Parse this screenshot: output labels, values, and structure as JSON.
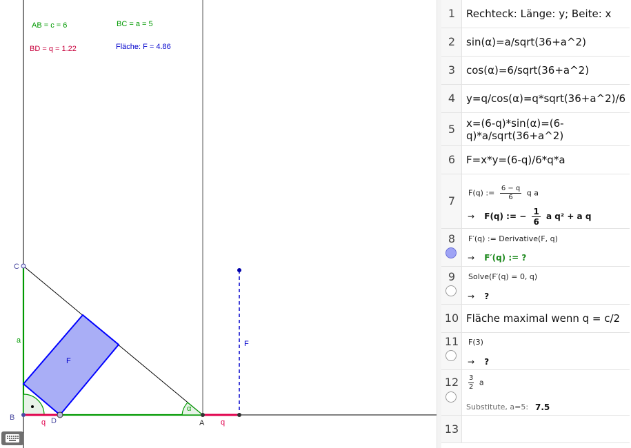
{
  "graphics": {
    "info_texts": {
      "ab": "AB = c = 6",
      "bc": "BC = a = 5",
      "bd": "BD = q = 1.22",
      "area": "Fläche: F = 4.86"
    },
    "point_labels": {
      "c": "C",
      "b": "B",
      "d": "D",
      "a": "A"
    },
    "segment_labels": {
      "a_side": "a",
      "q_left": "q",
      "q_right": "q",
      "f_rect": "F",
      "f_dashed": "F",
      "alpha": "α"
    },
    "colors": {
      "green": "#009900",
      "red": "#e0004c",
      "blue": "#0000ff",
      "rect_fill": "#9aa0f5",
      "magenta": "#c8003c"
    }
  },
  "cas": {
    "rows": [
      {
        "num": "1",
        "text": "Rechteck: Länge: y; Beite: x"
      },
      {
        "num": "2",
        "text": "sin(α)=a/sqrt(36+a^2)"
      },
      {
        "num": "3",
        "text": "cos(α)=6/sqrt(36+a^2)"
      },
      {
        "num": "4",
        "text": "y=q/cos(α)=q*sqrt(36+a^2)/6"
      },
      {
        "num": "5",
        "text_line1": "x=(6-q)*sin(α)=(6-",
        "text_line2": "q)*a/sqrt(36+a^2)"
      },
      {
        "num": "6",
        "text": "F=x*y=(6-q)/6*q*a"
      },
      {
        "num": "7",
        "input_prefix": "F(q) :=",
        "frac_num": "6 − q",
        "frac_den": "6",
        "input_suffix": "q a",
        "output_prefix": "F(q)  :=  −",
        "output_frac_num": "1",
        "output_frac_den": "6",
        "output_suffix": "a q² + a q"
      },
      {
        "num": "8",
        "input": "F′(q) := Derivative(F, q)",
        "output": "F′(q)  :=  ?"
      },
      {
        "num": "9",
        "input": "Solve(F′(q) = 0, q)",
        "output": "?"
      },
      {
        "num": "10",
        "text": "Fläche maximal wenn q = c/2"
      },
      {
        "num": "11",
        "input": "F(3)",
        "output": "?"
      },
      {
        "num": "12",
        "frac_num": "3",
        "frac_den": "2",
        "input_suffix": "a",
        "sub_label": "Substitute, a=5:",
        "sub_value": "7.5"
      },
      {
        "num": "13",
        "text": ""
      }
    ],
    "arrow": "→"
  },
  "keyboard": {
    "icon": "keyboard-icon"
  }
}
